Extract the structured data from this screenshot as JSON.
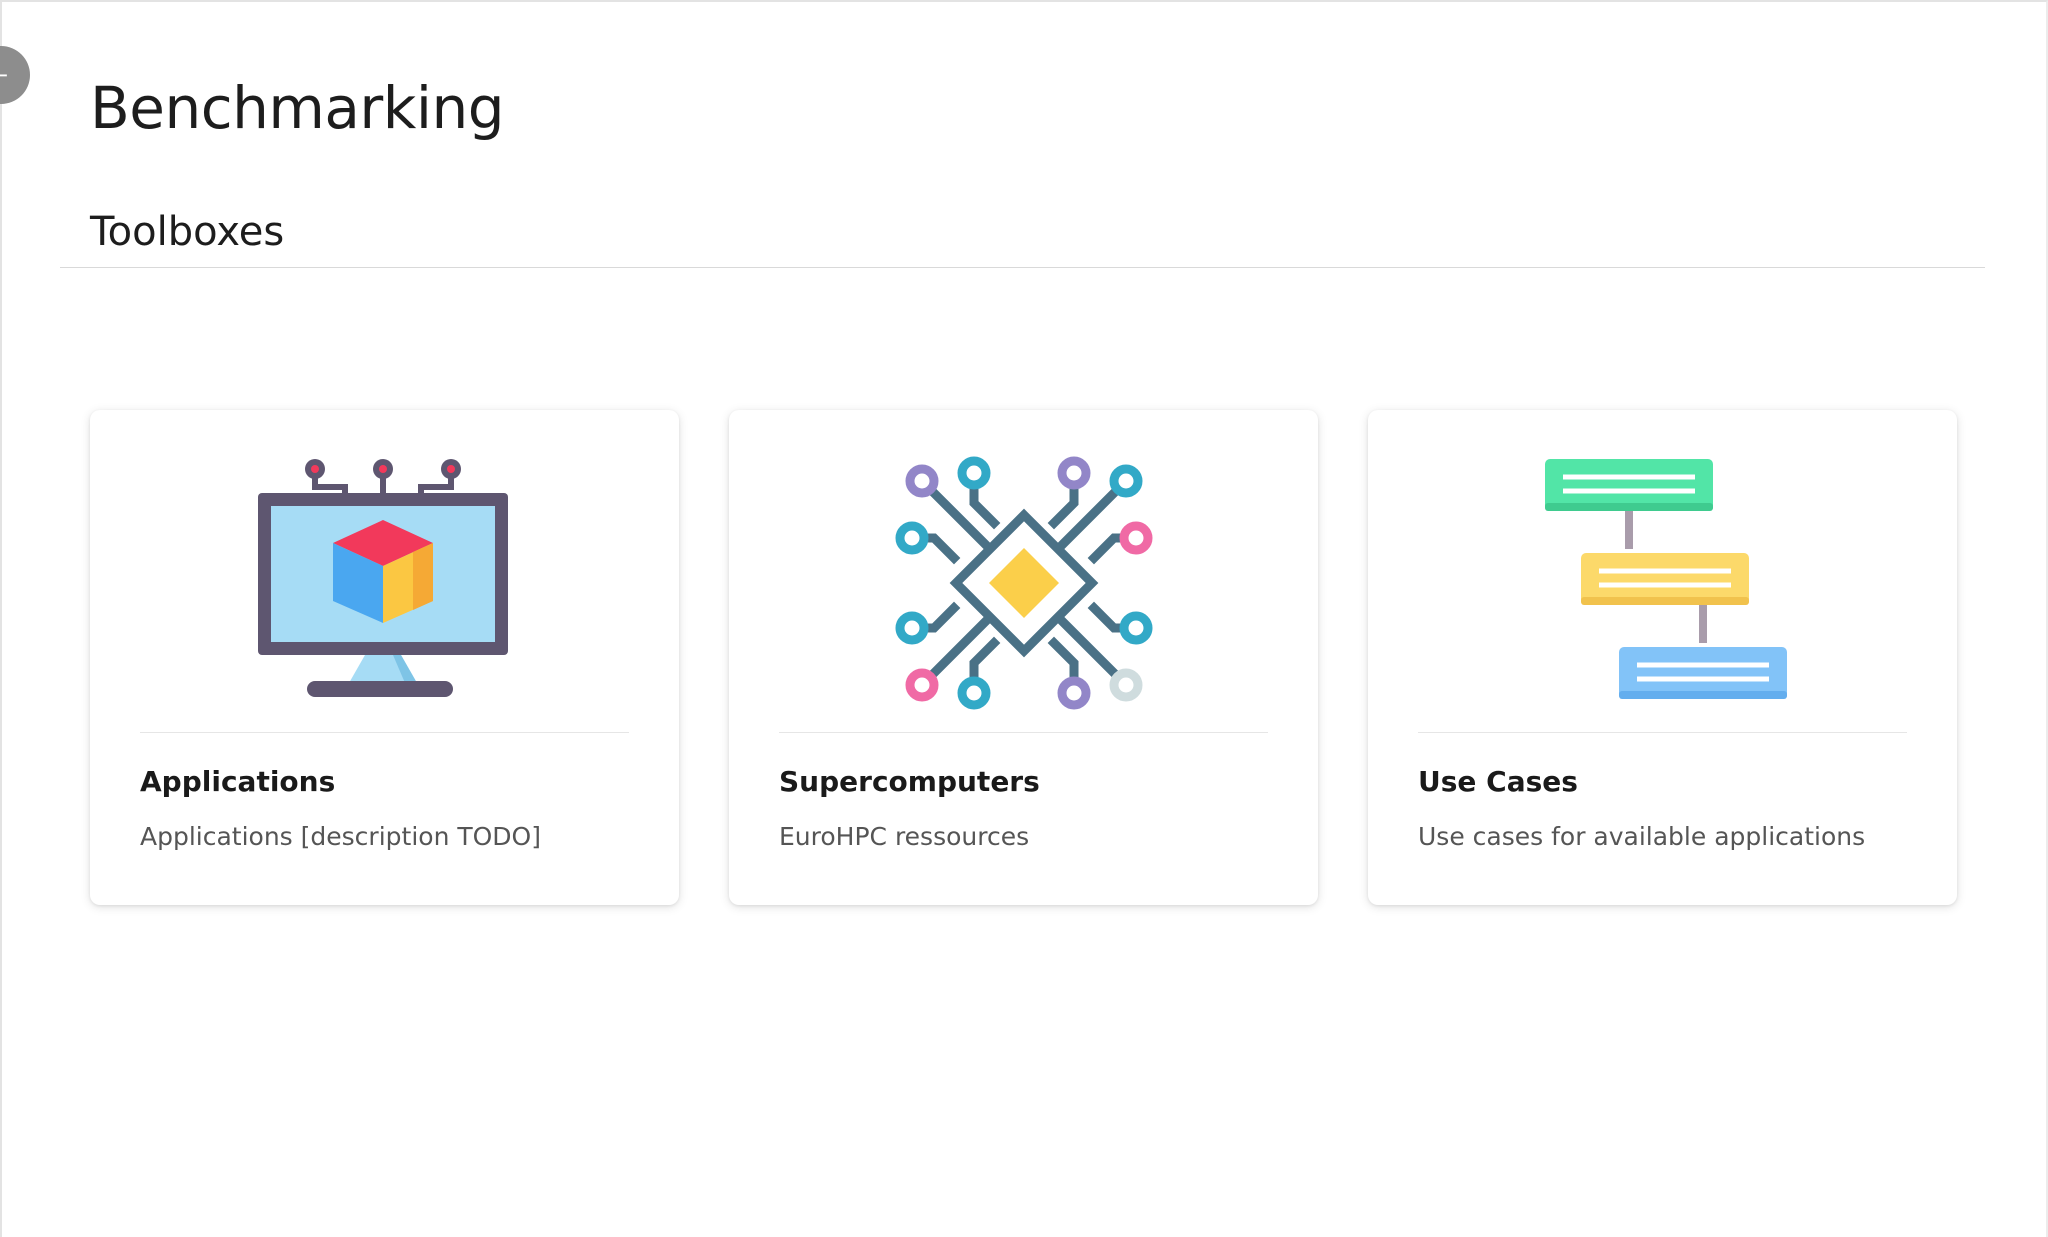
{
  "page": {
    "title": "Benchmarking",
    "section_title": "Toolboxes",
    "collapse_glyph": "−"
  },
  "cards": [
    {
      "title": "Applications",
      "description": "Applications [description TODO]",
      "icon": "monitor-cube-icon"
    },
    {
      "title": "Supercomputers",
      "description": "EuroHPC ressources",
      "icon": "processor-chip-icon"
    },
    {
      "title": "Use Cases",
      "description": "Use cases for available applications",
      "icon": "flowchart-icon"
    }
  ],
  "colors": {
    "text_primary": "#1d1d1d",
    "text_secondary": "#555555",
    "monitor_frame": "#5e5670",
    "screen": "#a6dcf5",
    "cube_red": "#f2395b",
    "cube_blue": "#4aa7f0",
    "cube_yellow": "#fbc742",
    "chip_trace": "#4a7186",
    "chip_core": "#fbcf4a",
    "node_teal": "#32a9c7",
    "node_purple": "#9286c8",
    "node_pink": "#f06aa5",
    "node_grey": "#cfdcde",
    "flow_green": "#52e5a7",
    "flow_yellow": "#fcd96a",
    "flow_blue": "#82c3f8",
    "flow_connector": "#a99cab"
  }
}
